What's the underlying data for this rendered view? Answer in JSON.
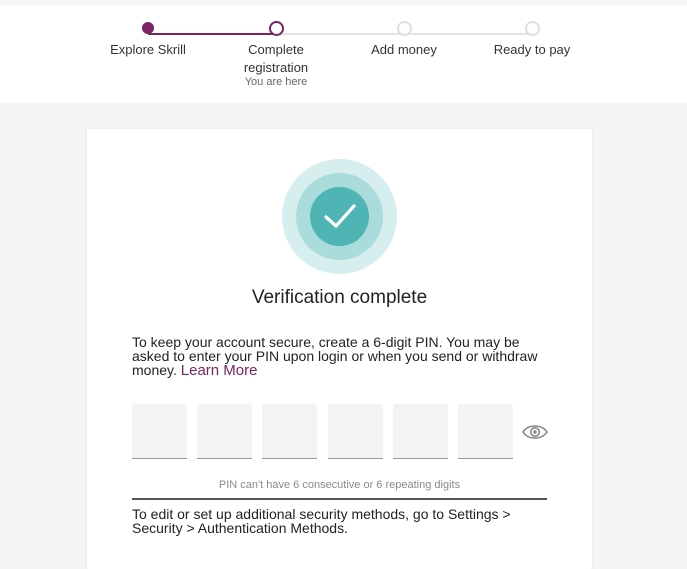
{
  "stepper": {
    "steps": [
      {
        "label": "Explore Skrill",
        "state": "done"
      },
      {
        "label": "Complete registration",
        "sub": "You are here",
        "state": "current"
      },
      {
        "label": "Add money",
        "state": "todo"
      },
      {
        "label": "Ready to pay",
        "state": "todo"
      }
    ]
  },
  "card": {
    "badge_icon": "checkmark-icon",
    "title": "Verification complete",
    "description": "To keep your account secure, create a 6-digit PIN. You may be asked to enter your PIN upon login or when you send or withdraw money.",
    "learn_more": "Learn More",
    "pin_hint": "PIN can't have 6 consecutive or 6 repeating digits",
    "pin_toggle_icon": "eye-icon",
    "footer": "To edit or set up additional security methods, go to Settings > Security > Authentication Methods."
  },
  "colors": {
    "accent": "#7b2563",
    "teal": "#4eb4b4"
  }
}
